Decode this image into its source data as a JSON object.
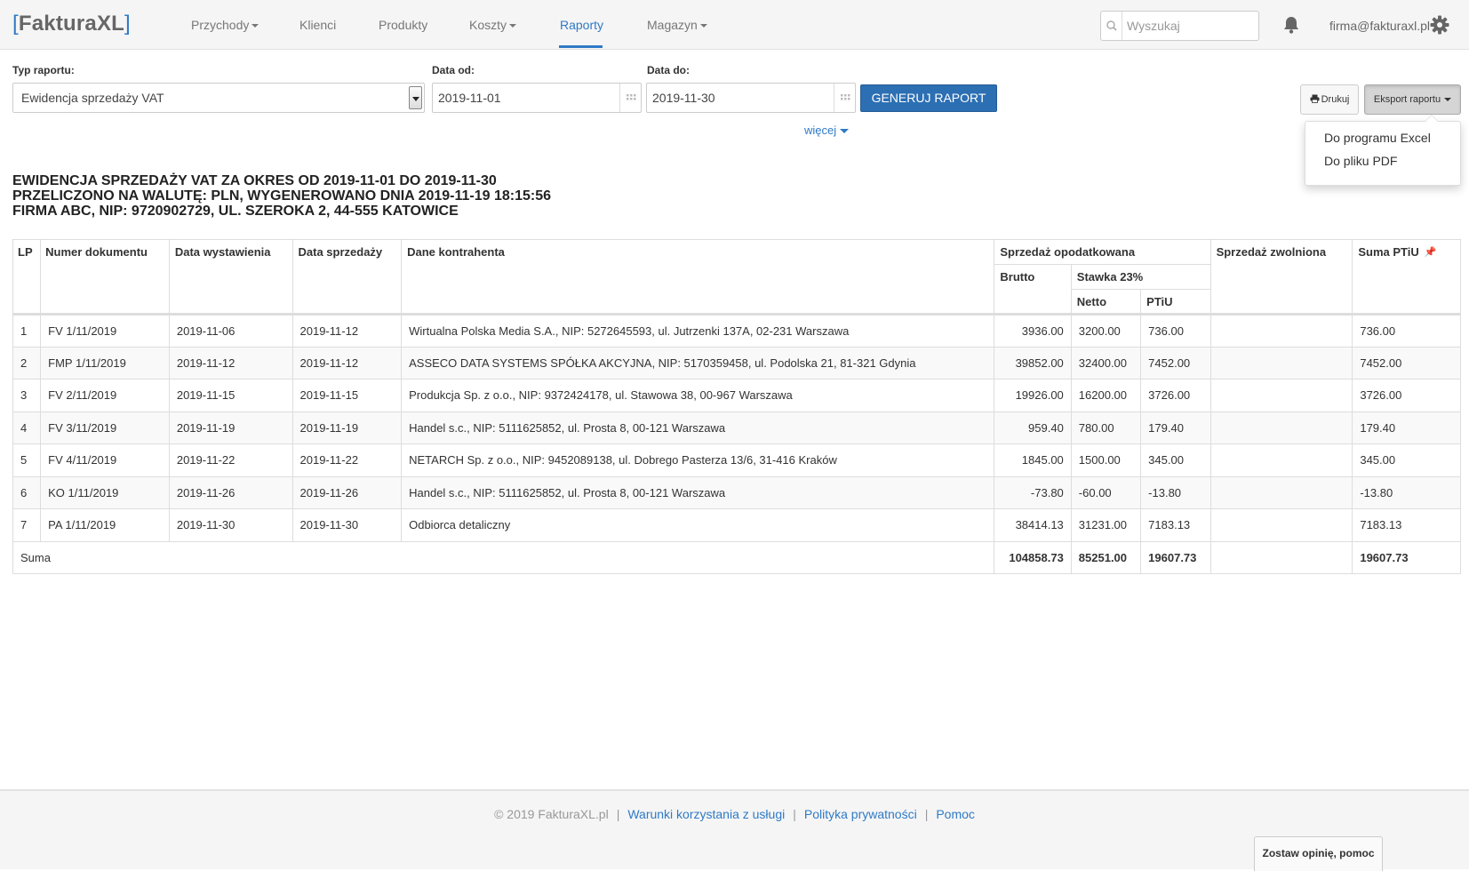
{
  "app": {
    "logo_open": "[",
    "logo_name": "FakturaXL",
    "logo_close": "]"
  },
  "nav": {
    "items": [
      {
        "label": "Przychody",
        "dropdown": true
      },
      {
        "label": "Klienci",
        "dropdown": false
      },
      {
        "label": "Produkty",
        "dropdown": false
      },
      {
        "label": "Koszty",
        "dropdown": true
      },
      {
        "label": "Raporty",
        "dropdown": false,
        "active": true
      },
      {
        "label": "Magazyn",
        "dropdown": true
      }
    ],
    "search_placeholder": "Wyszukaj",
    "user_email": "firma@fakturaxl.pl",
    "icons": [
      "search-icon",
      "bell-icon",
      "gear-icon"
    ]
  },
  "filters": {
    "report_type_label": "Typ raportu:",
    "report_type_value": "Ewidencja sprzedaży VAT",
    "date_from_label": "Data od:",
    "date_from_value": "2019-11-01",
    "date_to_label": "Data do:",
    "date_to_value": "2019-11-30",
    "generate_label": "GENERUJ RAPORT",
    "more_label": "więcej",
    "print_label": "Drukuj",
    "export_label": "Eksport raportu"
  },
  "export_menu": {
    "items": [
      "Do programu Excel",
      "Do pliku PDF"
    ]
  },
  "report": {
    "line1": "EWIDENCJA SPRZEDAŻY VAT ZA OKRES OD 2019-11-01 DO 2019-11-30",
    "line2": "PRZELICZONO NA WALUTĘ: PLN, WYGENEROWANO DNIA 2019-11-19 18:15:56",
    "line3": "FIRMA ABC, NIP: 9720902729, UL. SZEROKA 2, 44-555 KATOWICE"
  },
  "table": {
    "headers": {
      "lp": "LP",
      "doc": "Numer dokumentu",
      "issue": "Data wystawienia",
      "sale": "Data sprzedaży",
      "contractor": "Dane kontrahenta",
      "taxed": "Sprzedaż opodatkowana",
      "gross": "Brutto",
      "rate": "Stawka 23%",
      "net": "Netto",
      "vat": "PTiU",
      "exempt": "Sprzedaż zwolniona",
      "sum_vat": "Suma PTiU"
    },
    "rows": [
      {
        "lp": "1",
        "doc": "FV 1/11/2019",
        "issue": "2019-11-06",
        "sale": "2019-11-12",
        "contractor": "Wirtualna Polska Media S.A., NIP: 5272645593, ul. Jutrzenki 137A, 02-231 Warszawa",
        "gross": "3936.00",
        "net": "3200.00",
        "vat": "736.00",
        "exempt": "",
        "sum_vat": "736.00"
      },
      {
        "lp": "2",
        "doc": "FMP 1/11/2019",
        "issue": "2019-11-12",
        "sale": "2019-11-12",
        "contractor": "ASSECO DATA SYSTEMS SPÓŁKA AKCYJNA, NIP: 5170359458, ul. Podolska 21, 81-321 Gdynia",
        "gross": "39852.00",
        "net": "32400.00",
        "vat": "7452.00",
        "exempt": "",
        "sum_vat": "7452.00"
      },
      {
        "lp": "3",
        "doc": "FV 2/11/2019",
        "issue": "2019-11-15",
        "sale": "2019-11-15",
        "contractor": "Produkcja Sp. z o.o., NIP: 9372424178, ul. Stawowa 38, 00-967 Warszawa",
        "gross": "19926.00",
        "net": "16200.00",
        "vat": "3726.00",
        "exempt": "",
        "sum_vat": "3726.00"
      },
      {
        "lp": "4",
        "doc": "FV 3/11/2019",
        "issue": "2019-11-19",
        "sale": "2019-11-19",
        "contractor": "Handel s.c., NIP: 5111625852, ul. Prosta 8, 00-121 Warszawa",
        "gross": "959.40",
        "net": "780.00",
        "vat": "179.40",
        "exempt": "",
        "sum_vat": "179.40"
      },
      {
        "lp": "5",
        "doc": "FV 4/11/2019",
        "issue": "2019-11-22",
        "sale": "2019-11-22",
        "contractor": "NETARCH Sp. z o.o., NIP: 9452089138, ul. Dobrego Pasterza 13/6, 31-416 Kraków",
        "gross": "1845.00",
        "net": "1500.00",
        "vat": "345.00",
        "exempt": "",
        "sum_vat": "345.00"
      },
      {
        "lp": "6",
        "doc": "KO 1/11/2019",
        "issue": "2019-11-26",
        "sale": "2019-11-26",
        "contractor": "Handel s.c., NIP: 5111625852, ul. Prosta 8, 00-121 Warszawa",
        "gross": "-73.80",
        "net": "-60.00",
        "vat": "-13.80",
        "exempt": "",
        "sum_vat": "-13.80"
      },
      {
        "lp": "7",
        "doc": "PA 1/11/2019",
        "issue": "2019-11-30",
        "sale": "2019-11-30",
        "contractor": "Odbiorca detaliczny",
        "gross": "38414.13",
        "net": "31231.00",
        "vat": "7183.13",
        "exempt": "",
        "sum_vat": "7183.13"
      }
    ],
    "totals": {
      "label": "Suma",
      "gross": "104858.73",
      "net": "85251.00",
      "vat": "19607.73",
      "exempt": "",
      "sum_vat": "19607.73"
    }
  },
  "footer": {
    "copyright": "© 2019 FakturaXL.pl",
    "links": [
      "Warunki korzystania z usługi",
      "Polityka prywatności",
      "Pomoc"
    ],
    "separator": "|",
    "feedback_label": "Zostaw opinię, pomoc"
  },
  "colors": {
    "accent": "#2f7ac6",
    "primary_button": "#2c6fb3",
    "navbar_bg": "#f5f5f5"
  }
}
